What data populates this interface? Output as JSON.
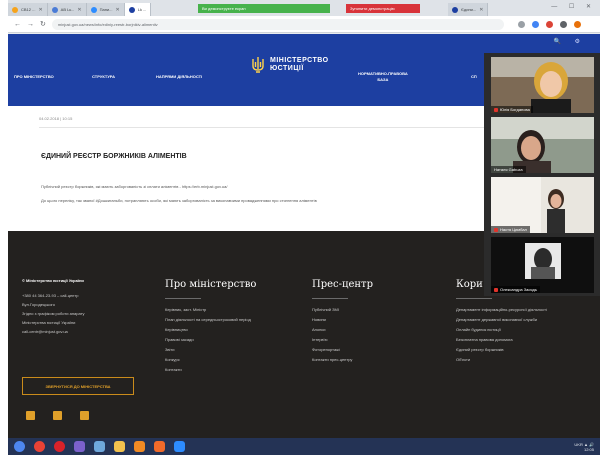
{
  "browser": {
    "tabs": [
      {
        "label": "СВ12 ..."
      },
      {
        "label": "AВ Lк..."
      },
      {
        "label": "Пани..."
      },
      {
        "label": "Lk ...",
        "active": true
      }
    ],
    "notifications": {
      "sharing": "Ви демонструєте екран",
      "stop": "Зупинити демонстрацію"
    },
    "extra_tab": "Єдини...",
    "window_controls": "—  ☐  ✕",
    "url": "minjust.gov.ua/news/info/ediniy-reestr-borjnikiv-alimentiv"
  },
  "site": {
    "header_icons": "🔍 ⚙",
    "menu": {
      "about": "ПРО МІНІСТЕРСТВО",
      "structure": "СТРУКТУРА",
      "directions": "НАПРЯМИ ДІЯЛЬНОСТІ",
      "normative_line1": "НОРМАТИВНО-ПРАВОВА",
      "normative_line2": "БАЗА",
      "more": "СП"
    },
    "logo": {
      "line1": "МІНІСТЕРСТВО",
      "line2": "ЮСТИЦІЇ"
    },
    "article": {
      "date": "04.02.2018  |  10:15",
      "title": "ЄДИНИЙ РЕЄСТР БОРЖНИКІВ АЛІМЕНТІВ",
      "para1": "Публічний реєстр боржників, які мають заборгованість зі сплати аліментів - https://erb.minjust.gov.ua/",
      "para2": "До цього переліку, так званої #Дошкиганьби, потрапляють особи, які мають заборгованість за виконавчими провадженнями про стягнення аліментів"
    },
    "footer": {
      "org": "© Міністерство юстиції України",
      "contacts": [
        "+380 44 364-23-93 – call-центр",
        "Вул.Городецького",
        "Згідно з графіком роботи апарату",
        "Міністерства юстиції України",
        "call-centr@minjust.gov.ua"
      ],
      "button": "ЗВЕРНУТИСЯ ДО МІНІСТЕРСТВА",
      "columns": [
        {
          "heading": "Про міністерство",
          "links": [
            "Керівник, заст. Міністр",
            "План діяльності на середньостроковий період",
            "Керівництво",
            "Правові засади",
            "Звіти",
            "Конкурс",
            "Контакти"
          ]
        },
        {
          "heading": "Прес-центр",
          "links": [
            "Публічний ЗМІ",
            "Новини",
            "Анонси",
            "Інтерв'ю",
            "Фоторепортажі",
            "Контакти прес-центру"
          ]
        },
        {
          "heading": "Кори",
          "links": [
            "Департамент інформаційно-ресурсної діяльності",
            "Департамент державної виконавчої служби",
            "Онлайн будинок юстиції",
            "Безоплатна правова допомога",
            "Єдиний реєстр боржників",
            "Об'єкти"
          ]
        }
      ]
    }
  },
  "video_call": {
    "participants": [
      {
        "name": "Юлія Богданова"
      },
      {
        "name": "Наталя Gabuza"
      },
      {
        "name": "Настя Цимбал"
      },
      {
        "name": "Олександра Засядь"
      }
    ]
  },
  "taskbar": {
    "tray_line1": "UKR   ▲ 🔊",
    "tray_line2": "12:05"
  },
  "colors": {
    "brand_blue": "#1d3fa1",
    "footer_bg": "#23211f",
    "accent_gold": "#e0a02a",
    "taskbar_bg": "#243355"
  }
}
